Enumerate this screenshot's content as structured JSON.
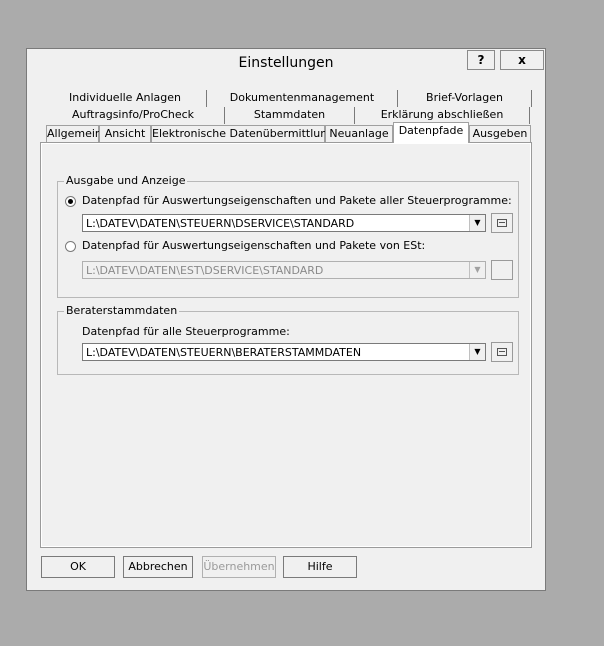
{
  "window": {
    "title": "Einstellungen",
    "help_label": "?",
    "close_label": "x"
  },
  "tabs": {
    "row1": [
      "Individuelle Anlagen",
      "Dokumentenmanagement",
      "Brief-Vorlagen"
    ],
    "row2": [
      "Auftragsinfo/ProCheck",
      "Stammdaten",
      "Erklärung abschließen"
    ],
    "row3": [
      "Allgemein",
      "Ansicht",
      "Elektronische Datenübermittlung",
      "Neuanlage",
      "Datenpfade",
      "Ausgeben"
    ],
    "active": "Datenpfade"
  },
  "group_output": {
    "title": "Ausgabe und Anzeige",
    "option1_label": "Datenpfad für Auswertungseigenschaften und Pakete aller Steuerprogramme:",
    "option1_value": "L:\\DATEV\\DATEN\\STEUERN\\DSERVICE\\STANDARD",
    "option1_checked": true,
    "option2_label": "Datenpfad für Auswertungseigenschaften und Pakete von ESt:",
    "option2_value": "L:\\DATEV\\DATEN\\EST\\DSERVICE\\STANDARD",
    "option2_checked": false
  },
  "group_berater": {
    "title": "Beraterstammdaten",
    "field_label": "Datenpfad für alle Steuerprogramme:",
    "field_value": "L:\\DATEV\\DATEN\\STEUERN\\BERATERSTAMMDATEN"
  },
  "buttons": {
    "ok": "OK",
    "cancel": "Abbrechen",
    "apply": "Übernehmen",
    "help": "Hilfe"
  }
}
